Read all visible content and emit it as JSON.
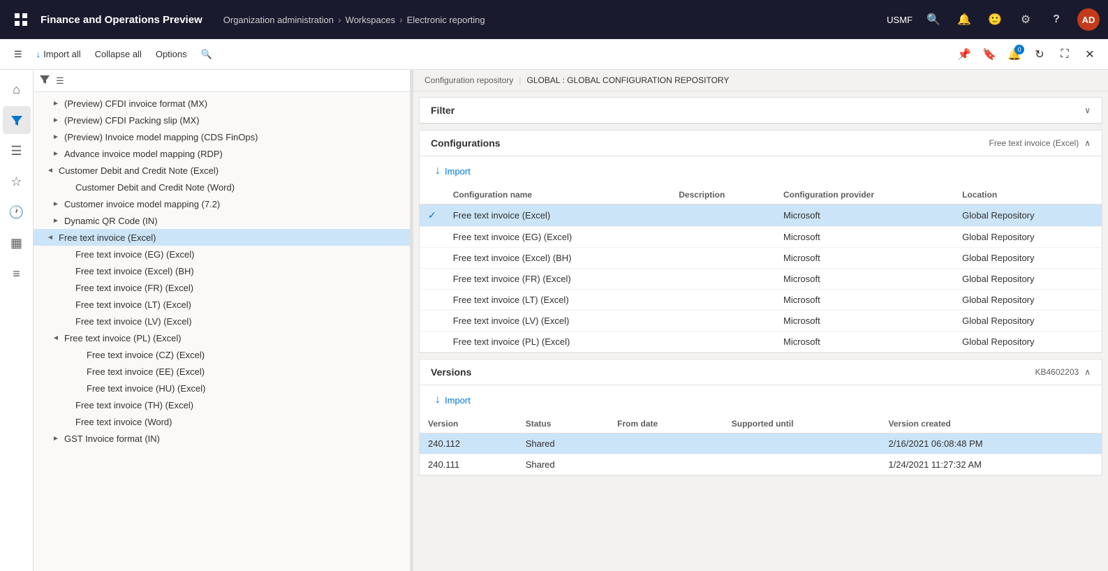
{
  "app": {
    "title": "Finance and Operations Preview",
    "company": "USMF"
  },
  "breadcrumb": {
    "items": [
      "Organization administration",
      "Workspaces",
      "Electronic reporting"
    ]
  },
  "toolbar": {
    "import_all": "Import all",
    "collapse_all": "Collapse all",
    "options": "Options"
  },
  "right_header": {
    "label": "Configuration repository",
    "separator": "|",
    "value": "GLOBAL : GLOBAL CONFIGURATION REPOSITORY"
  },
  "filter_section": {
    "title": "Filter"
  },
  "configurations_section": {
    "title": "Configurations",
    "badge": "Free text invoice (Excel)",
    "import_label": "Import",
    "columns": [
      "Configuration name",
      "Description",
      "Configuration provider",
      "Location"
    ],
    "rows": [
      {
        "name": "Free text invoice (Excel)",
        "description": "",
        "provider": "Microsoft",
        "location": "Global Repository",
        "selected": true
      },
      {
        "name": "Free text invoice (EG) (Excel)",
        "description": "",
        "provider": "Microsoft",
        "location": "Global Repository",
        "selected": false
      },
      {
        "name": "Free text invoice (Excel) (BH)",
        "description": "",
        "provider": "Microsoft",
        "location": "Global Repository",
        "selected": false
      },
      {
        "name": "Free text invoice (FR) (Excel)",
        "description": "",
        "provider": "Microsoft",
        "location": "Global Repository",
        "selected": false
      },
      {
        "name": "Free text invoice (LT) (Excel)",
        "description": "",
        "provider": "Microsoft",
        "location": "Global Repository",
        "selected": false
      },
      {
        "name": "Free text invoice (LV) (Excel)",
        "description": "",
        "provider": "Microsoft",
        "location": "Global Repository",
        "selected": false
      },
      {
        "name": "Free text invoice (PL) (Excel)",
        "description": "",
        "provider": "Microsoft",
        "location": "Global Repository",
        "selected": false,
        "partial": true
      }
    ]
  },
  "versions_section": {
    "title": "Versions",
    "badge": "KB4602203",
    "import_label": "Import",
    "columns": [
      "Version",
      "Status",
      "From date",
      "Supported until",
      "Version created"
    ],
    "rows": [
      {
        "version": "240.112",
        "status": "Shared",
        "from_date": "",
        "supported_until": "",
        "version_created": "2/16/2021 06:08:48 PM",
        "selected": true
      },
      {
        "version": "240.111",
        "status": "Shared",
        "from_date": "",
        "supported_until": "",
        "version_created": "1/24/2021 11:27:32 AM",
        "selected": false
      }
    ]
  },
  "tree": {
    "items": [
      {
        "label": "(Preview) CFDI invoice format (MX)",
        "indent": 1,
        "expand": false,
        "selected": false
      },
      {
        "label": "(Preview) CFDI Packing slip (MX)",
        "indent": 1,
        "expand": false,
        "selected": false
      },
      {
        "label": "(Preview) Invoice model mapping (CDS FinOps)",
        "indent": 1,
        "expand": false,
        "selected": false
      },
      {
        "label": "Advance invoice model mapping (RDP)",
        "indent": 1,
        "expand": false,
        "selected": false
      },
      {
        "label": "Customer Debit and Credit Note (Excel)",
        "indent": 0,
        "expand": true,
        "selected": false
      },
      {
        "label": "Customer Debit and Credit Note (Word)",
        "indent": 2,
        "expand": false,
        "selected": false
      },
      {
        "label": "Customer invoice model mapping (7.2)",
        "indent": 1,
        "expand": false,
        "selected": false
      },
      {
        "label": "Dynamic QR Code (IN)",
        "indent": 1,
        "expand": false,
        "selected": false
      },
      {
        "label": "Free text invoice (Excel)",
        "indent": 0,
        "expand": true,
        "selected": true
      },
      {
        "label": "Free text invoice (EG) (Excel)",
        "indent": 2,
        "expand": false,
        "selected": false
      },
      {
        "label": "Free text invoice (Excel) (BH)",
        "indent": 2,
        "expand": false,
        "selected": false
      },
      {
        "label": "Free text invoice (FR) (Excel)",
        "indent": 2,
        "expand": false,
        "selected": false
      },
      {
        "label": "Free text invoice (LT) (Excel)",
        "indent": 2,
        "expand": false,
        "selected": false
      },
      {
        "label": "Free text invoice (LV) (Excel)",
        "indent": 2,
        "expand": false,
        "selected": false
      },
      {
        "label": "Free text invoice (PL) (Excel)",
        "indent": 1,
        "expand": true,
        "selected": false
      },
      {
        "label": "Free text invoice (CZ) (Excel)",
        "indent": 3,
        "expand": false,
        "selected": false
      },
      {
        "label": "Free text invoice (EE) (Excel)",
        "indent": 3,
        "expand": false,
        "selected": false
      },
      {
        "label": "Free text invoice (HU) (Excel)",
        "indent": 3,
        "expand": false,
        "selected": false
      },
      {
        "label": "Free text invoice (TH) (Excel)",
        "indent": 2,
        "expand": false,
        "selected": false
      },
      {
        "label": "Free text invoice (Word)",
        "indent": 2,
        "expand": false,
        "selected": false
      },
      {
        "label": "GST Invoice format (IN)",
        "indent": 1,
        "expand": false,
        "selected": false
      }
    ]
  },
  "icons": {
    "grid": "⊞",
    "filter": "⊡",
    "apps": "⠿",
    "search": "🔍",
    "bell": "🔔",
    "smiley": "🙂",
    "settings": "⚙",
    "question": "?",
    "chevron_down": "∨",
    "chevron_up": "∧",
    "chevron_right": "›",
    "collapse": "▲",
    "import_arrow": "↓",
    "home": "⌂",
    "star": "☆",
    "clock": "🕐",
    "table": "▦",
    "list": "≡",
    "hamburger": "☰",
    "pin": "📌",
    "bookmark": "🔖",
    "refresh": "↻",
    "expand_window": "⛶",
    "close": "✕"
  }
}
